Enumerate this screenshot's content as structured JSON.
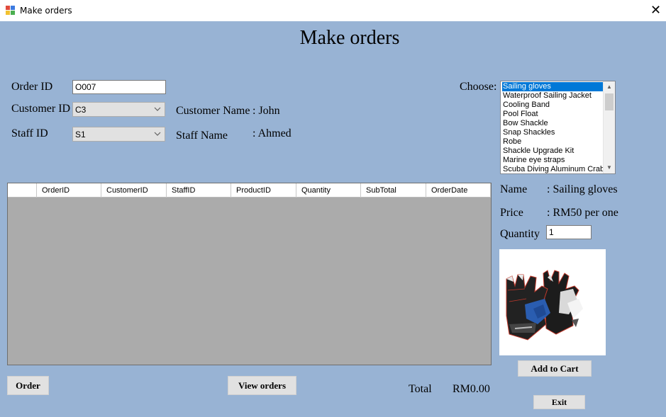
{
  "window": {
    "title": "Make orders",
    "close_glyph": "✕"
  },
  "heading": "Make orders",
  "form": {
    "order_id_label": "Order ID",
    "order_id_value": "O007",
    "customer_id_label": "Customer ID",
    "customer_id_value": "C3",
    "staff_id_label": "Staff ID",
    "staff_id_value": "S1",
    "customer_name_label": "Customer Name",
    "customer_name_value": ": John",
    "staff_name_label": "Staff Name",
    "staff_name_value": ": Ahmed"
  },
  "choose": {
    "label": "Choose:",
    "items": [
      "Sailing gloves",
      "Waterproof Sailing Jacket",
      "Cooling Band",
      "Pool Float",
      "Bow Shackle",
      "Snap Shackles",
      "Robe",
      "Shackle Upgrade Kit",
      "Marine eye straps",
      "Scuba Diving Aluminum Crab"
    ],
    "selected": "Sailing gloves"
  },
  "grid": {
    "columns": [
      "OrderID",
      "CustomerID",
      "StaffID",
      "ProductID",
      "Quantity",
      "SubTotal",
      "OrderDate"
    ],
    "rows": []
  },
  "product": {
    "name_label": "Name",
    "name_value": ": Sailing gloves",
    "price_label": "Price",
    "price_value": ": RM50 per one",
    "quantity_label": "Quantity",
    "quantity_value": "1",
    "image_icon": "sailing-gloves-image"
  },
  "buttons": {
    "order": "Order",
    "view_orders": "View orders",
    "add_to_cart": "Add to Cart",
    "exit": "Exit"
  },
  "total": {
    "label": "Total",
    "value": "RM0.00"
  },
  "colors": {
    "background": "#98b3d4",
    "grid_background": "#ababab",
    "selection": "#0078d7"
  }
}
